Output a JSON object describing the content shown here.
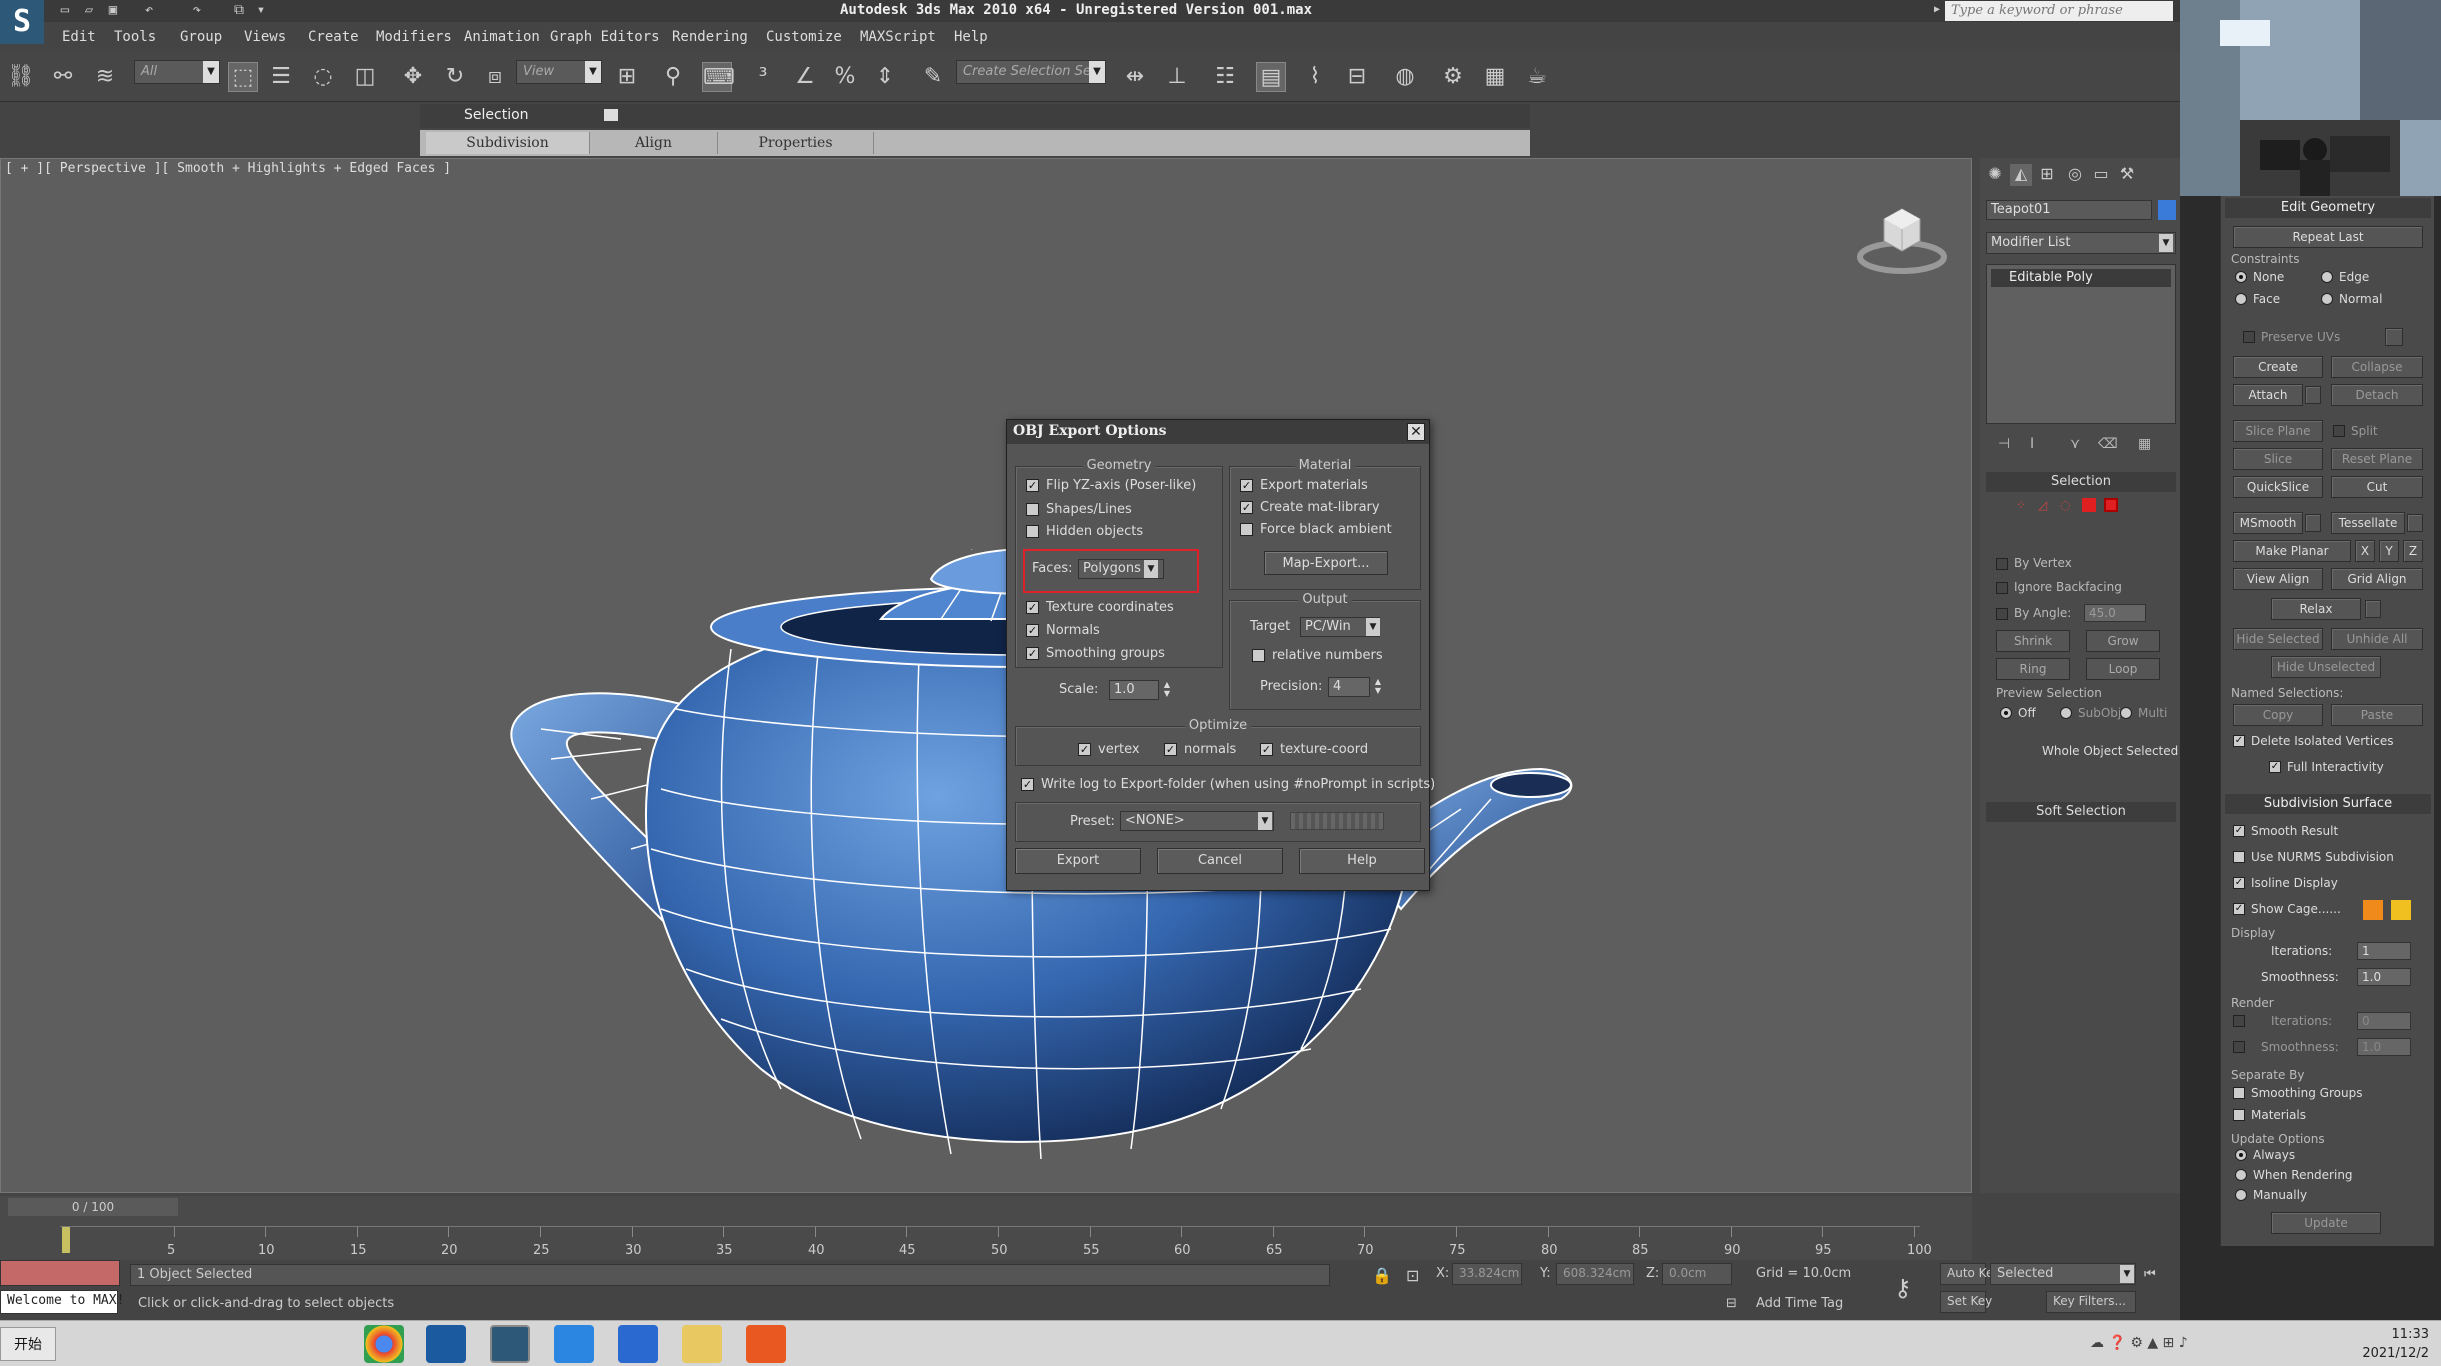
{
  "app": {
    "title": "Autodesk 3ds Max  2010 x64  - Unregistered Version  001.max",
    "search_placeholder": "Type a keyword or phrase",
    "logo": "S"
  },
  "menubar": {
    "items": [
      "Edit",
      "Tools",
      "Group",
      "Views",
      "Create",
      "Modifiers",
      "Animation",
      "Graph Editors",
      "Rendering",
      "Customize",
      "MAXScript",
      "Help"
    ]
  },
  "toolbar": {
    "selection_filter": "All",
    "ref_coord": "View",
    "selection_set": "Create Selection Se"
  },
  "ribbon": {
    "header": "Selection",
    "tabs": [
      "Subdivision",
      "Align",
      "Properties"
    ]
  },
  "viewport": {
    "label": "[ + ][ Perspective ][ Smooth + Highlights + Edged Faces ]"
  },
  "dialog": {
    "title": "OBJ Export Options",
    "geometry": {
      "title": "Geometry",
      "flip_yz": "Flip YZ-axis (Poser-like)",
      "shapes_lines": "Shapes/Lines",
      "hidden_objects": "Hidden objects",
      "faces_label": "Faces:",
      "faces_value": "Polygons",
      "texture_coords": "Texture coordinates",
      "normals": "Normals",
      "smoothing_groups": "Smoothing groups",
      "scale_label": "Scale:",
      "scale_value": "1.0"
    },
    "material": {
      "title": "Material",
      "export_materials": "Export materials",
      "create_mat_library": "Create mat-library",
      "force_black_ambient": "Force black ambient",
      "map_export": "Map-Export..."
    },
    "output": {
      "title": "Output",
      "target_label": "Target",
      "target_value": "PC/Win",
      "relative_numbers": "relative numbers",
      "precision_label": "Precision:",
      "precision_value": "4"
    },
    "optimize": {
      "title": "Optimize",
      "vertex": "vertex",
      "normals": "normals",
      "texture_coord": "texture-coord"
    },
    "write_log": "Write log to Export-folder (when using #noPrompt in scripts)",
    "preset_label": "Preset:",
    "preset_value": "<NONE>",
    "export_button": "Export",
    "cancel_button": "Cancel",
    "help_button": "Help"
  },
  "command_panel": {
    "object_name": "Teapot01",
    "object_color": "#3a7ad8",
    "modifier_list": "Modifier List",
    "stack_item": "Editable Poly",
    "selection_rollout": "Selection",
    "by_vertex": "By Vertex",
    "ignore_backfacing": "Ignore Backfacing",
    "by_angle": "By Angle:",
    "by_angle_value": "45.0",
    "shrink": "Shrink",
    "grow": "Grow",
    "ring": "Ring",
    "loop": "Loop",
    "preview_selection": "Preview Selection",
    "preview_off": "Off",
    "preview_subobj": "SubObj",
    "preview_multi": "Multi",
    "whole_object_selected": "Whole Object Selected",
    "soft_selection": "Soft Selection"
  },
  "edit_geometry": {
    "title": "Edit Geometry",
    "repeat_last": "Repeat Last",
    "constraints": "Constraints",
    "none": "None",
    "edge": "Edge",
    "face": "Face",
    "normal": "Normal",
    "preserve_uvs": "Preserve UVs",
    "create": "Create",
    "collapse": "Collapse",
    "attach": "Attach",
    "detach": "Detach",
    "slice_plane": "Slice Plane",
    "split": "Split",
    "slice": "Slice",
    "reset_plane": "Reset Plane",
    "quickslice": "QuickSlice",
    "cut": "Cut",
    "msmooth": "MSmooth",
    "tessellate": "Tessellate",
    "make_planar": "Make Planar",
    "x": "X",
    "y": "Y",
    "z": "Z",
    "view_align": "View Align",
    "grid_align": "Grid Align",
    "relax": "Relax",
    "hide_selected": "Hide Selected",
    "unhide_all": "Unhide All",
    "hide_unselected": "Hide Unselected",
    "named_selections": "Named Selections:",
    "copy": "Copy",
    "paste": "Paste",
    "delete_isolated": "Delete Isolated Vertices",
    "full_interactivity": "Full Interactivity"
  },
  "subdivision_surface": {
    "title": "Subdivision Surface",
    "smooth_result": "Smooth Result",
    "use_nurms": "Use NURMS Subdivision",
    "isoline_display": "Isoline Display",
    "show_cage": "Show Cage......",
    "cage_color_1": "#f08a1a",
    "cage_color_2": "#f0c020",
    "display": "Display",
    "iterations_label": "Iterations:",
    "display_iterations": "1",
    "smoothness_label": "Smoothness:",
    "display_smoothness": "1.0",
    "render": "Render",
    "render_iterations": "0",
    "render_smoothness": "1.0",
    "separate_by": "Separate By",
    "smoothing_groups": "Smoothing Groups",
    "materials": "Materials",
    "update_options": "Update Options",
    "always": "Always",
    "when_rendering": "When Rendering",
    "manually": "Manually",
    "update": "Update"
  },
  "timeline": {
    "slider_label": "0 / 100",
    "ticks": [
      "5",
      "10",
      "15",
      "20",
      "25",
      "30",
      "35",
      "40",
      "45",
      "50",
      "55",
      "60",
      "65",
      "70",
      "75",
      "80",
      "85",
      "90",
      "95",
      "100"
    ]
  },
  "statusbar": {
    "objects_selected": "1 Object Selected",
    "prompt": "Click or click-and-drag to select objects",
    "welcome": "Welcome to MAX!",
    "x_label": "X:",
    "x_value": "33.824cm",
    "y_label": "Y:",
    "y_value": "608.324cm",
    "z_label": "Z:",
    "z_value": "0.0cm",
    "grid": "Grid = 10.0cm",
    "add_time_tag": "Add Time Tag",
    "auto_key": "Auto Key",
    "set_key": "Set Key",
    "selected": "Selected",
    "key_filters": "Key Filters...",
    "frame": "0"
  },
  "taskbar": {
    "start": "开始",
    "time": "11:33",
    "date": "2021/12/2"
  }
}
